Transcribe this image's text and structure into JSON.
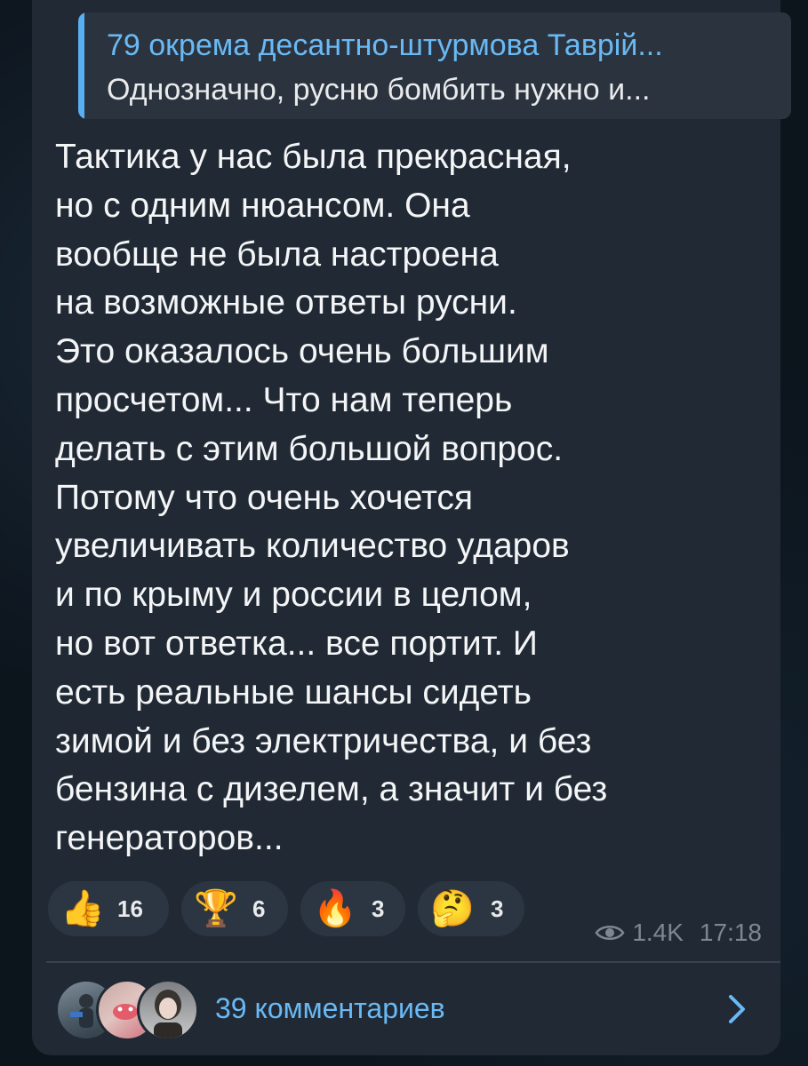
{
  "reply": {
    "title": "79 окрема десантно-штурмова Таврій...",
    "text": "Однозначно, русню бомбить нужно и..."
  },
  "message": {
    "lines": [
      "Тактика у нас была прекрасная,",
      "но с одним нюансом. Она",
      "вообще не была настроена",
      "на возможные ответы русни.",
      "Это оказалось очень большим",
      "просчетом... Что нам теперь",
      "делать с этим большой вопрос.",
      "Потому что очень хочется",
      "увеличивать количество ударов",
      "и по крыму и россии в целом,",
      "но вот ответка... все портит. И",
      "есть реальные шансы сидеть",
      "зимой и без электричества, и без",
      "бензина с дизелем, а значит и без",
      "генераторов..."
    ]
  },
  "reactions": [
    {
      "emoji": "👍",
      "icon": "thumbs-up-icon",
      "count": "16"
    },
    {
      "emoji": "🏆",
      "icon": "trophy-icon",
      "count": "6"
    },
    {
      "emoji": "🔥",
      "icon": "fire-icon",
      "count": "3"
    },
    {
      "emoji": "🤔",
      "icon": "thinking-face-icon",
      "count": "3"
    }
  ],
  "meta": {
    "views": "1.4K",
    "time": "17:18"
  },
  "comments": {
    "label": "39 комментариев"
  },
  "colors": {
    "accent": "#6ab9f5",
    "bubble": "#212a34",
    "text": "#f4f5f7"
  }
}
